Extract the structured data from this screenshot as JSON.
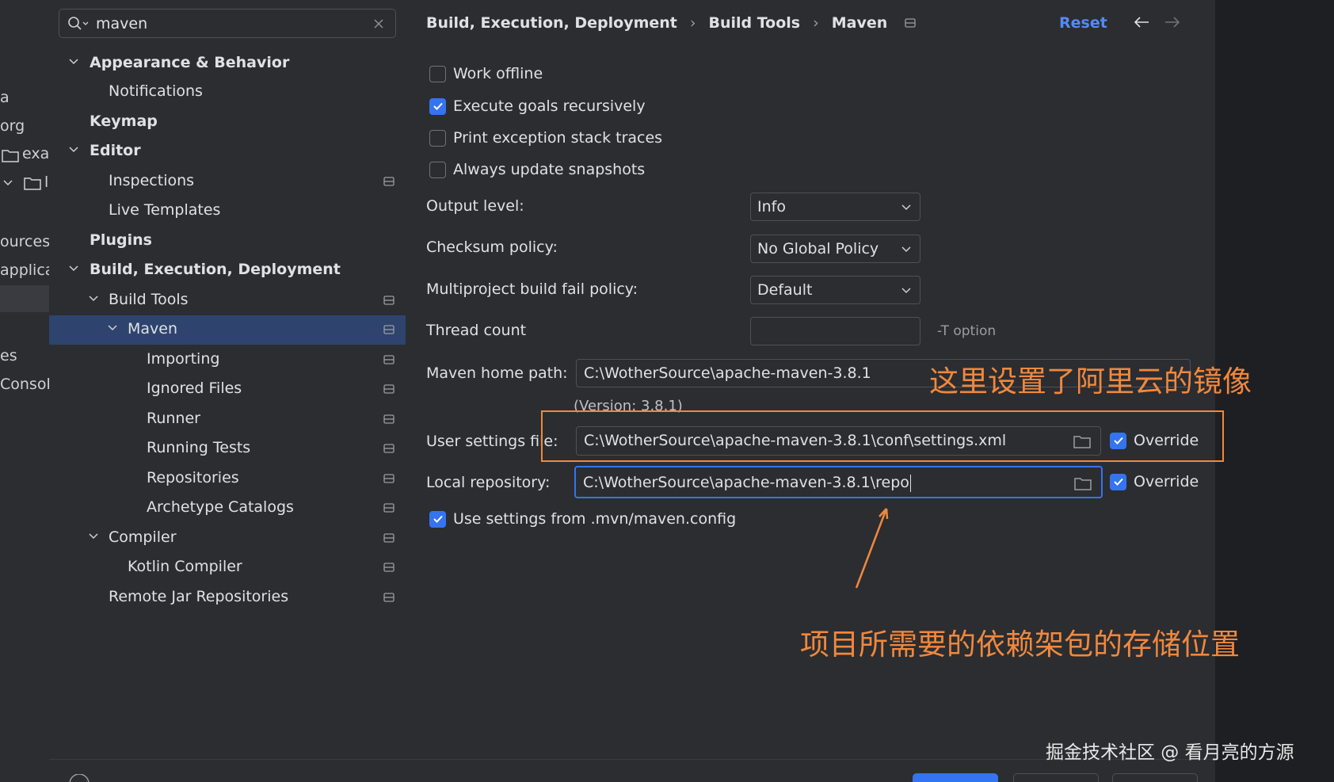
{
  "project_panel": {
    "items": [
      "a",
      "org",
      "exa",
      "l",
      "ources",
      "applica",
      "es",
      "Console"
    ]
  },
  "search": {
    "value": "maven"
  },
  "tree": {
    "appearance": "Appearance & Behavior",
    "notifications": "Notifications",
    "keymap": "Keymap",
    "editor": "Editor",
    "inspections": "Inspections",
    "live_templates": "Live Templates",
    "plugins": "Plugins",
    "build_exec_deploy": "Build, Execution, Deployment",
    "build_tools": "Build Tools",
    "maven": "Maven",
    "importing": "Importing",
    "ignored_files": "Ignored Files",
    "runner": "Runner",
    "running_tests": "Running Tests",
    "repositories": "Repositories",
    "archetype_catalogs": "Archetype Catalogs",
    "compiler": "Compiler",
    "kotlin_compiler": "Kotlin Compiler",
    "remote_jar_repositories": "Remote Jar Repositories"
  },
  "header": {
    "crumb1": "Build, Execution, Deployment",
    "crumb2": "Build Tools",
    "crumb3": "Maven",
    "separator": "›",
    "reset": "Reset"
  },
  "options": {
    "work_offline": "Work offline",
    "execute_goals": "Execute goals recursively",
    "print_exception": "Print exception stack traces",
    "always_update": "Always update snapshots",
    "use_mvn_config": "Use settings from .mvn/maven.config"
  },
  "fields": {
    "output_level_label": "Output level:",
    "output_level_value": "Info",
    "checksum_label": "Checksum policy:",
    "checksum_value": "No Global Policy",
    "multiproject_label": "Multiproject build fail policy:",
    "multiproject_value": "Default",
    "thread_count_label": "Thread count",
    "thread_count_value": "",
    "thread_hint": "-T option",
    "maven_home_label": "Maven home path:",
    "maven_home_value": "C:\\WotherSource\\apache-maven-3.8.1",
    "version": "(Version: 3.8.1)",
    "user_settings_label": "User settings file:",
    "user_settings_value": "C:\\WotherSource\\apache-maven-3.8.1\\conf\\settings.xml",
    "local_repo_label": "Local repository:",
    "local_repo_value": "C:\\WotherSource\\apache-maven-3.8.1\\repo",
    "override": "Override"
  },
  "annotations": {
    "mirror_note": "这里设置了阿里云的镜像",
    "repo_note": "项目所需要的依赖架包的存储位置",
    "watermark": "掘金技术社区 @ 看月亮的方源"
  },
  "colors": {
    "accent": "#3574f0",
    "annotation": "#f0883e",
    "link": "#548af7"
  }
}
